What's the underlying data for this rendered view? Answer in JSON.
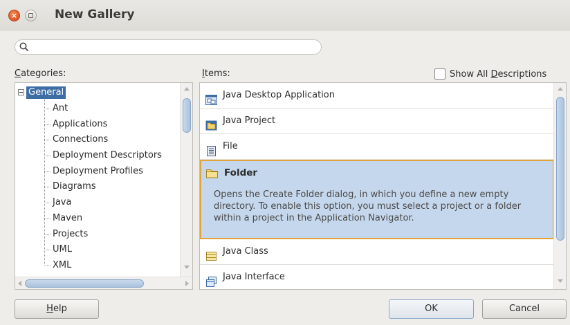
{
  "window": {
    "title": "New Gallery",
    "close_glyph": "×"
  },
  "search": {
    "value": "",
    "placeholder": ""
  },
  "categories": {
    "label_accel": "C",
    "label_rest": "ategories:",
    "root": "General",
    "items": [
      "Ant",
      "Applications",
      "Connections",
      "Deployment Descriptors",
      "Deployment Profiles",
      "Diagrams",
      "Java",
      "Maven",
      "Projects",
      "UML",
      "XML"
    ]
  },
  "items_panel": {
    "label_accel": "I",
    "label_rest": "tems:",
    "show_all_label_pre": "Show All ",
    "show_all_label_accel": "D",
    "show_all_label_post": "escriptions",
    "show_all_checked": false,
    "items": [
      {
        "name": "Java Desktop Application",
        "icon": "desktop-app-icon"
      },
      {
        "name": "Java Project",
        "icon": "project-icon"
      },
      {
        "name": "File",
        "icon": "file-icon"
      },
      {
        "name": "Folder",
        "icon": "folder-icon",
        "selected": true,
        "description": "Opens the Create Folder dialog, in which you define a new empty directory. To enable this option, you must select a project or a folder within a project in the Application Navigator."
      },
      {
        "name": "Java Class",
        "icon": "java-class-icon"
      },
      {
        "name": "Java Interface",
        "icon": "java-interface-icon"
      }
    ]
  },
  "buttons": {
    "help_accel": "H",
    "help_rest": "elp",
    "ok": "OK",
    "cancel": "Cancel"
  },
  "colors": {
    "selection": "#3e6da6",
    "selected_item_bg": "#c5d7ec",
    "selected_item_border": "#e2a33a",
    "close_button": "#e35d2a"
  }
}
